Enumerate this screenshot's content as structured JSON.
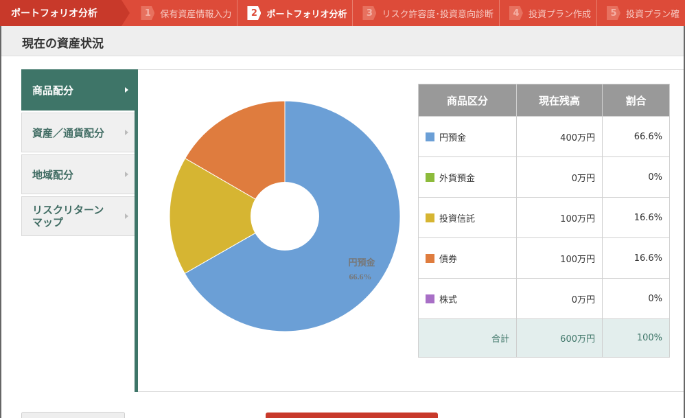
{
  "topbar": {
    "brand": "ポートフォリオ分析",
    "steps": [
      {
        "num": "1",
        "label": "保有資産情報入力"
      },
      {
        "num": "2",
        "label": "ポートフォリオ分析"
      },
      {
        "num": "3",
        "label": "リスク許容度･投資意向診断"
      },
      {
        "num": "4",
        "label": "投資プラン作成"
      },
      {
        "num": "5",
        "label": "投資プラン確"
      }
    ]
  },
  "header": {
    "title": "現在の資産状況"
  },
  "sidenav": {
    "items": [
      {
        "label": "商品配分"
      },
      {
        "label": "資産／通貨配分"
      },
      {
        "label": "地域配分"
      },
      {
        "label": "リスクリターン\nマップ"
      }
    ]
  },
  "chart_data": {
    "type": "pie",
    "donut": true,
    "slices": [
      {
        "name": "円預金",
        "value": 66.6,
        "color": "#6b9fd6"
      },
      {
        "name": "外貨預金",
        "value": 0,
        "color": "#8dbb3b"
      },
      {
        "name": "投資信託",
        "value": 16.6,
        "color": "#d6b532"
      },
      {
        "name": "債券",
        "value": 16.6,
        "color": "#df7c3e"
      },
      {
        "name": "株式",
        "value": 0,
        "color": "#a86fc6"
      }
    ],
    "annotations": [
      {
        "label": "円預金",
        "value": "66.6%"
      }
    ]
  },
  "table": {
    "headers": [
      "商品区分",
      "現在残高",
      "割合"
    ],
    "rows": [
      {
        "name": "円預金",
        "balance": "400万円",
        "ratio": "66.6%",
        "color": "#6b9fd6"
      },
      {
        "name": "外貨預金",
        "balance": "0万円",
        "ratio": "0%",
        "color": "#8dbb3b"
      },
      {
        "name": "投資信託",
        "balance": "100万円",
        "ratio": "16.6%",
        "color": "#d6b532"
      },
      {
        "name": "債券",
        "balance": "100万円",
        "ratio": "16.6%",
        "color": "#df7c3e"
      },
      {
        "name": "株式",
        "balance": "0万円",
        "ratio": "0%",
        "color": "#a86fc6"
      }
    ],
    "total": {
      "label": "合計",
      "balance": "600万円",
      "ratio": "100%"
    }
  }
}
